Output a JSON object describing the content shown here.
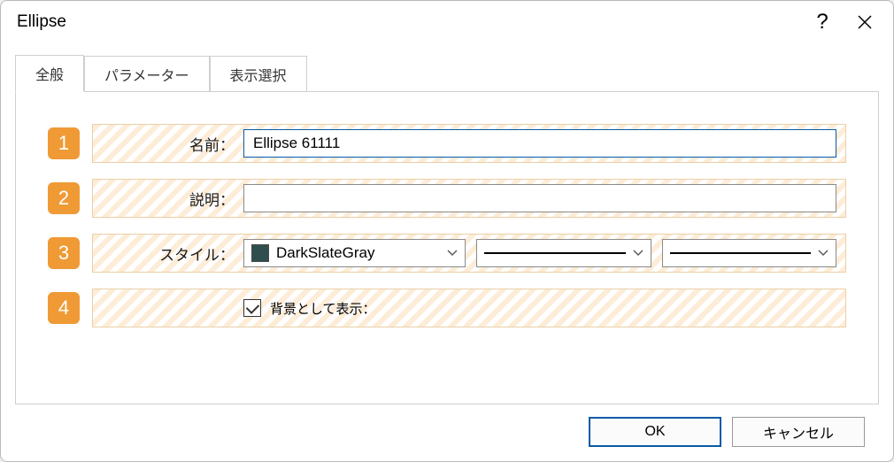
{
  "title": "Ellipse",
  "tabs": {
    "general": "全般",
    "parameters": "パラメーター",
    "display": "表示選択"
  },
  "rows": {
    "name": {
      "num": "1",
      "label": "名前：",
      "value": "Ellipse 61111"
    },
    "desc": {
      "num": "2",
      "label": "説明：",
      "value": ""
    },
    "style": {
      "num": "3",
      "label": "スタイル：",
      "colorName": "DarkSlateGray"
    },
    "bg": {
      "num": "4",
      "label": "背景として表示：",
      "checked": true
    }
  },
  "buttons": {
    "ok": "OK",
    "cancel": "キャンセル"
  }
}
